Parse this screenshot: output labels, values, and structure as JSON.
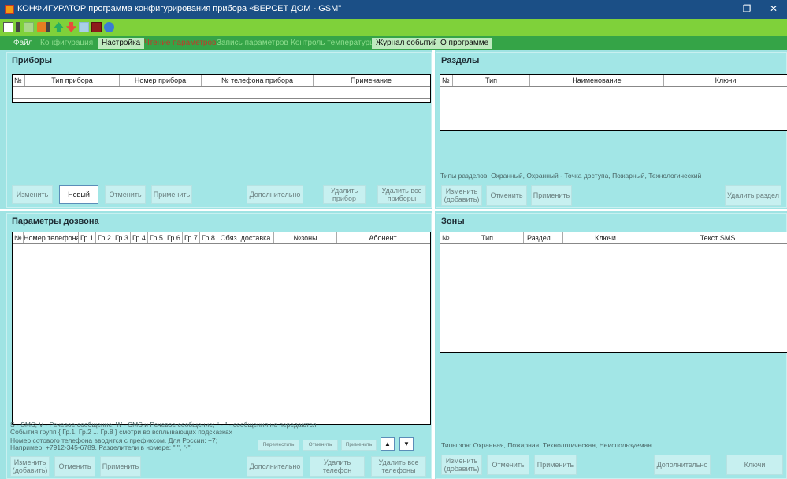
{
  "window": {
    "title": "КОНФИГУРАТОР программа конфигурирования прибора «ВЕРСЕТ ДОМ - GSM\"",
    "minimize_glyph": "—",
    "maximize_glyph": "❐",
    "close_glyph": "✕"
  },
  "menu": {
    "file": "Файл",
    "configuration": "Конфигурация",
    "settings": "Настройка",
    "read_params": "Чтение параметров",
    "write_params": "Запись параметров",
    "temp_control": "Контроль температуры",
    "event_log": "Журнал событий",
    "about": "О программе"
  },
  "devices": {
    "title": "Приборы",
    "columns": [
      "№",
      "Тип прибора",
      "Номер прибора",
      "№ телефона прибора",
      "Примечание"
    ],
    "btn_edit": "Изменить",
    "btn_new": "Новый",
    "btn_cancel": "Отменить",
    "btn_apply": "Применить",
    "btn_more": "Дополнительно",
    "btn_delete": "Удалить прибор",
    "btn_delete_all": "Удалить все приборы"
  },
  "sections": {
    "title": "Разделы",
    "columns": [
      "№",
      "Тип",
      "Наименование",
      "Ключи"
    ],
    "types_note": "Типы разделов: Охранный, Охранный - Точка доступа, Пожарный, Технологический",
    "btn_edit": "Изменить (добавить)",
    "btn_cancel": "Отменить",
    "btn_apply": "Применить",
    "btn_delete": "Удалить раздел"
  },
  "dial": {
    "title": "Параметры дозвона",
    "columns": [
      "№",
      "Номер телефона",
      "Гр.1",
      "Гр.2",
      "Гр.3",
      "Гр.4",
      "Гр.5",
      "Гр.6",
      "Гр.7",
      "Гр.8",
      "Обяз. доставка",
      "№зоны",
      "Абонент"
    ],
    "note1": "S - SMS;   V - Речевое сообщение;   W - SMS и Речевое сообщение; \" - \" - сообщения не передаются",
    "note2": "События групп { Гр.1, Гр.2 ... Гр.8 } смотри во всплывающих подсказках",
    "note3": "Номер сотового телефона вводится с префиксом. Для России: +7;",
    "note4": "Например: +7912-345-6789. Разделители в номере: \" \", \"-\".",
    "btn_move": "Переместить",
    "btn_cancel_small": "Отменить",
    "btn_apply_small": "Применить",
    "btn_up_glyph": "▲",
    "btn_down_glyph": "▼",
    "btn_edit": "Изменить (добавить)",
    "btn_cancel": "Отменить",
    "btn_apply": "Применить",
    "btn_more": "Дополнительно",
    "btn_delete": "Удалить телефон",
    "btn_delete_all": "Удалить все телефоны"
  },
  "zones": {
    "title": "Зоны",
    "columns": [
      "№",
      "Тип",
      "Раздел",
      "Ключи",
      "Текст SMS"
    ],
    "types_note": "Типы зон: Охранная, Пожарная, Технологическая, Неиспользуемая",
    "btn_edit": "Изменить (добавить)",
    "btn_cancel": "Отменить",
    "btn_apply": "Применить",
    "btn_more": "Дополнительно",
    "btn_keys": "Ключи"
  },
  "colors": {
    "titlebar": "#1b4f86",
    "toolbar": "#7fd13a",
    "menubar": "#35a447",
    "panel": "#a2e6e6"
  }
}
